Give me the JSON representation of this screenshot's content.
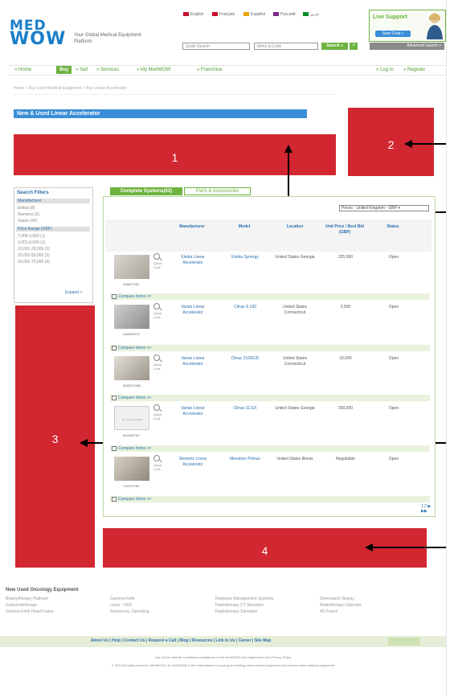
{
  "header": {
    "logo_top": "MED",
    "logo_bottom": "WOW",
    "tagline": "Your Global Medical Equipment Platform",
    "languages": [
      {
        "label": "English",
        "color": "#c8102e"
      },
      {
        "label": "Français",
        "color": "#c8102e"
      },
      {
        "label": "Español",
        "color": "#e8a200"
      },
      {
        "label": "Pусский",
        "color": "#7a2a8a"
      },
      {
        "label": "عربي",
        "color": "#0a8a2a"
      }
    ],
    "search_placeholder": "Quick Search",
    "search_select": "Items to Look",
    "search_button": "Search »",
    "advanced_search": "Advanced search »",
    "live_support_title": "Live Support",
    "live_support_button": "Start Chat »"
  },
  "nav": {
    "items": [
      "Home",
      "Buy",
      "Sell",
      "Services",
      "My MedWOW",
      "Franchise"
    ],
    "active": "Buy",
    "login": "Log In",
    "register": "Register"
  },
  "breadcrumb": "Home > Buy Used Medical Equipment > Buy Linear Accelerator",
  "page_title": "New & Used Linear Accelerator",
  "annotations": [
    "1",
    "2",
    "3",
    "4"
  ],
  "filters": {
    "title": "Search Filters",
    "manufacturer_heading": "Manufacturer",
    "manufacturers": [
      "Elekta (8)",
      "Siemens (3)",
      "Varian (42)"
    ],
    "price_heading": "Price Range (GBP)",
    "prices": [
      "7,000-3,000 (1)",
      "3,001-6,000 (1)",
      "10,001-20,000 (3)",
      "20,001-50,000 (3)",
      "50,001-75,000 (3)"
    ],
    "expand": "Expand"
  },
  "tabs": [
    "Complete Systems(62)",
    "Parts & Accessories"
  ],
  "country_select": "Prices - United Kingdom - GBP",
  "columns": [
    "Manufacturer",
    "Model",
    "Location",
    "Unit Price / Best Bid (GBP)",
    "Status"
  ],
  "rows": [
    {
      "id": "3356073B1",
      "manufacturer": "Elekta Linear Accelerator",
      "model": "Elekta Synergy",
      "location": "United States Georgia",
      "price": "225,000",
      "status": "Open"
    },
    {
      "id": "2460B0FF3",
      "manufacturer": "Varian Linear Accelerator",
      "model": "Clinac 6 100",
      "location": "United States Connecticut",
      "price": "2,500",
      "status": "Open"
    },
    {
      "id": "6566722586",
      "manufacturer": "Varian Linear Accelerator",
      "model": "Clinac 2100C/D",
      "location": "United States Connecticut",
      "price": "15,000",
      "status": "Open"
    },
    {
      "id": "6603457E4",
      "manufacturer": "Varian Linear Accelerator",
      "model": "Clinac 21 EX",
      "location": "United States Georgia",
      "price": "350,000",
      "status": "Open"
    },
    {
      "id": "7243787B2",
      "manufacturer": "Siemens Linear Accelerator",
      "model": "Mevatron Primus",
      "location": "United States Illinois",
      "price": "Negotiable",
      "status": "Open"
    }
  ],
  "quick_look": "Quick Look",
  "no_image": "No Image Available",
  "compare": "Compare Items >>",
  "pager": "1 2 ▶ ▶▶",
  "footer": {
    "title": "New Used Oncology Equipment",
    "col1": [
      "Brachytherapy Platinum",
      "Cyberknife/Image",
      "Gamma Knife Head Frame"
    ],
    "col2": [
      "Gamma Knife",
      "Laser - FRD",
      "Resources, Operating"
    ],
    "col3": [
      "Radiation Management Systems",
      "Radiotherapy CT Simulator",
      "Radiotherapy Simulator"
    ],
    "col4": [
      "Stereotactic Biopsy",
      "Radiotherapy Calendar",
      "4D Frame"
    ],
    "links": "About Us | Help | Contact Us | Request a Call | Blog | Resources | Link to Us | Career | Site Map",
    "legal1": "Use of this website constitutes acceptance of the MedWOW User Agreement and Privacy Policy",
    "legal2": "© 2013 All rights reserved. MedWOW Ltd. MedWOW is the marketplace for buying and selling used medical equipment and second hand medical equipment"
  }
}
